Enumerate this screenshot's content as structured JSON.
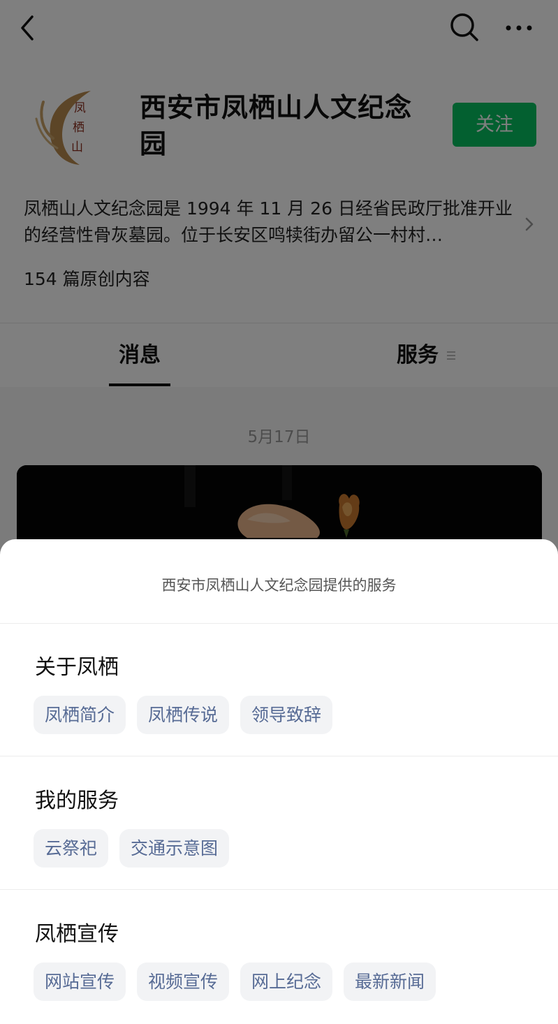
{
  "account": {
    "name": "西安市凤栖山人文纪念园",
    "follow_label": "关注",
    "description": "凤栖山人文纪念园是 1994 年 11 月 26 日经省民政厅批准开业的经营性骨灰墓园。位于长安区鸣犊街办留公一村村…",
    "article_count": "154 篇原创内容",
    "logo_text": "凤栖山"
  },
  "tabs": {
    "messages": "消息",
    "services": "服务"
  },
  "feed": {
    "date": "5月17日"
  },
  "sheet": {
    "title": "西安市凤栖山人文纪念园提供的服务",
    "groups": [
      {
        "title": "关于凤栖",
        "items": [
          "凤栖简介",
          "凤栖传说",
          "领导致辞"
        ]
      },
      {
        "title": "我的服务",
        "items": [
          "云祭祀",
          "交通示意图"
        ]
      },
      {
        "title": "凤栖宣传",
        "items": [
          "网站宣传",
          "视频宣传",
          "网上纪念",
          "最新新闻"
        ]
      }
    ]
  },
  "icons": {
    "back": "back-arrow-icon",
    "search": "search-icon",
    "more": "more-dots-icon",
    "chevron": "chevron-right-icon",
    "menu": "menu-lines-icon"
  },
  "colors": {
    "follow_button": "#07c160",
    "chip_text": "#576b95",
    "chip_bg": "#f2f3f5"
  }
}
